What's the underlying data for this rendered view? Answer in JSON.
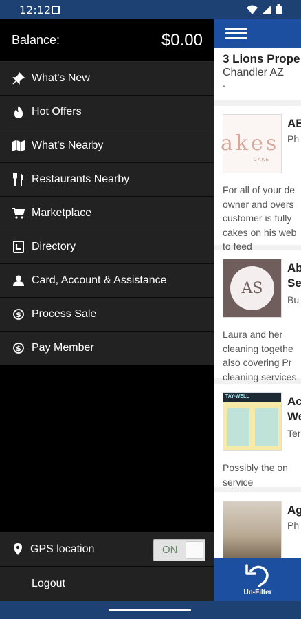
{
  "status": {
    "time": "12:12"
  },
  "drawer": {
    "balance_label": "Balance:",
    "balance_value": "$0.00",
    "menu": [
      {
        "label": "What's New",
        "icon": "pin-icon"
      },
      {
        "label": "Hot Offers",
        "icon": "flame-icon"
      },
      {
        "label": "What's Nearby",
        "icon": "map-icon"
      },
      {
        "label": "Restaurants Nearby",
        "icon": "utensils-icon"
      },
      {
        "label": "Marketplace",
        "icon": "cart-icon"
      },
      {
        "label": "Directory",
        "icon": "directory-icon"
      },
      {
        "label": "Card, Account & Assistance",
        "icon": "user-icon"
      },
      {
        "label": "Process Sale",
        "icon": "dollar-icon"
      },
      {
        "label": "Pay Member",
        "icon": "dollar-icon"
      }
    ],
    "gps_label": "GPS location",
    "gps_toggle": "ON",
    "logout_label": "Logout"
  },
  "background": {
    "business_name": "3 Lions Prope",
    "business_city": "Chandler AZ",
    "business_dot": ".",
    "cards": [
      {
        "title": "AE",
        "subtitle": "Ph",
        "image_text": "akes",
        "image_sub": "CAKE",
        "desc": [
          "For all of your de",
          "owner and overs",
          "customer is fully",
          "cakes on his web",
          "to feed"
        ]
      },
      {
        "title": "Ab",
        "title2": "Se",
        "subtitle": "Bu",
        "image_text": "AS",
        "desc": [
          "Laura and her",
          "cleaning togethe",
          "also covering Pr",
          "cleaning services"
        ]
      },
      {
        "title": "Ac",
        "title2": "We",
        "subtitle": "Ter",
        "image_text": "TAY-WELL",
        "desc": [
          "Possibly the on",
          "service"
        ]
      },
      {
        "title": "Ag",
        "subtitle": "Ph",
        "desc": []
      }
    ],
    "unfilter_label": "Un-Filter"
  },
  "colors": {
    "drawer_bg": "#000000",
    "menu_item_bg": "#222222",
    "brand_blue": "#1c4fa0",
    "status_bar": "#1c4172"
  }
}
